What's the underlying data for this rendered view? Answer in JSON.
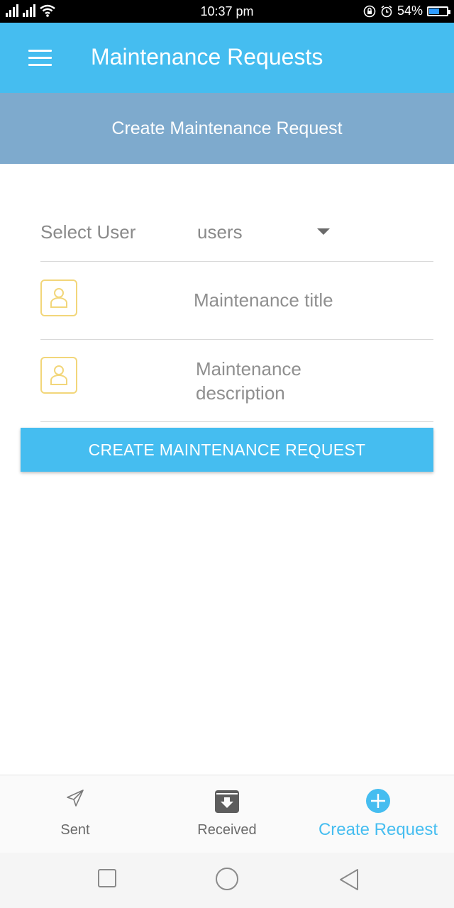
{
  "status_bar": {
    "time": "10:37 pm",
    "battery": "54%",
    "battery_level": 0.54
  },
  "app_bar": {
    "title": "Maintenance Requests",
    "menu_icon": "hamburger-menu-icon"
  },
  "subheader": {
    "title": "Create Maintenance Request"
  },
  "form": {
    "select_label": "Select User",
    "select_value": "users",
    "title_placeholder": "Maintenance title",
    "description_placeholder": "Maintenance description",
    "submit_label": "CREATE MAINTENANCE REQUEST"
  },
  "bottom_nav": {
    "items": [
      {
        "label": "Sent",
        "icon": "paper-plane-icon"
      },
      {
        "label": "Received",
        "icon": "inbox-download-icon"
      },
      {
        "label": "Create Request",
        "icon": "plus-circle-icon"
      }
    ]
  },
  "colors": {
    "primary": "#45bdf0",
    "subheader": "#7eaacd",
    "icon_accent": "#f2d67a",
    "text_muted": "#8a8a8a"
  }
}
